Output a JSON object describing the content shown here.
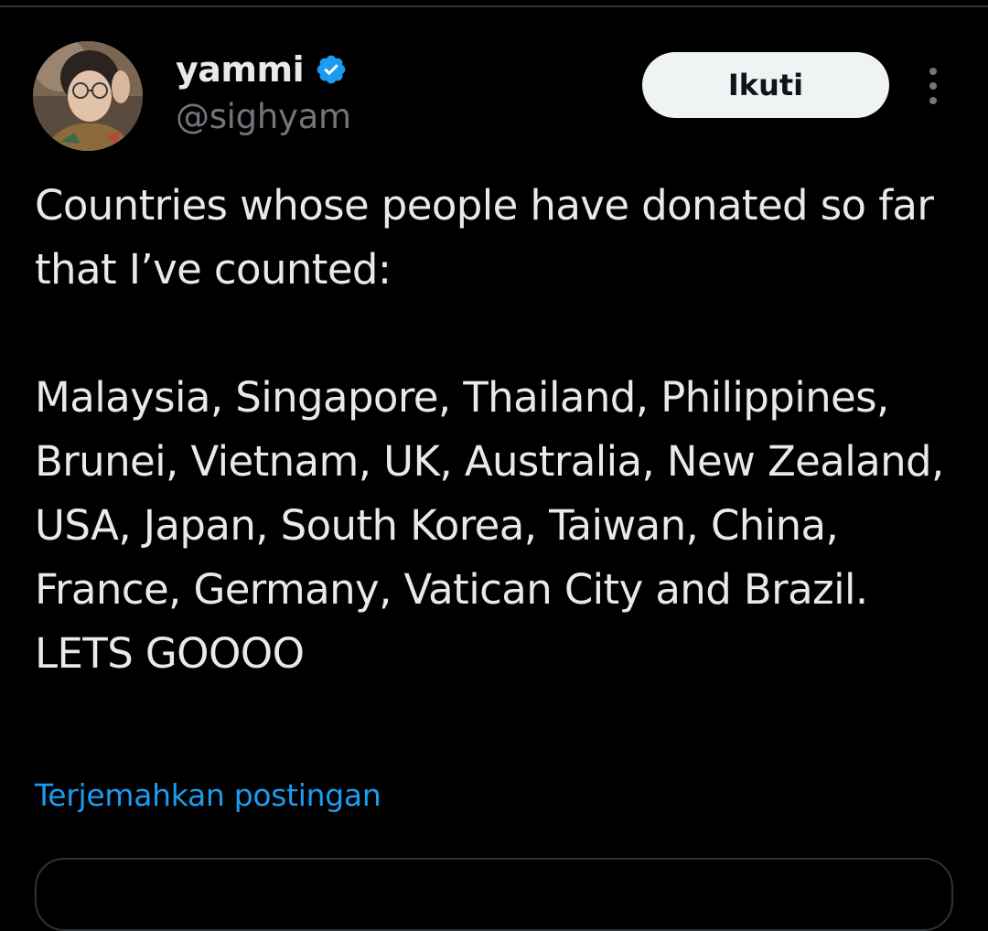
{
  "author": {
    "name": "yammi",
    "handle": "@sighyam",
    "verified": true
  },
  "follow_button": {
    "label": "Ikuti"
  },
  "tweet": {
    "text": "Countries whose people have donated so far that I’ve counted:\n\nMalaysia, Singapore, Thailand, Philippines, Brunei, Vietnam, UK, Australia, New Zealand, USA, Japan, South Korea, Taiwan, China, France, Germany, Vatican City and Brazil. LETS GOOOO"
  },
  "translate_link": "Terjemahkan postingan",
  "icons": {
    "verified": "verified-badge-icon",
    "more": "more-vertical-icon"
  },
  "colors": {
    "background": "#000000",
    "text_primary": "#e7e9ea",
    "text_secondary": "#71767b",
    "accent_blue": "#1d9bf0",
    "follow_button_bg": "#eff3f4",
    "border": "#2f3336"
  }
}
